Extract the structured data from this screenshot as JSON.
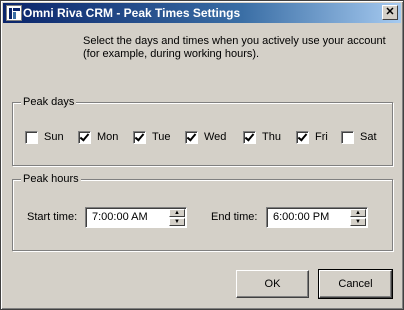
{
  "window": {
    "title": "Omni Riva CRM - Peak Times Settings",
    "close_glyph": "✕"
  },
  "intro_text": "Select the days and times when you actively use your account (for example, during working hours).",
  "peak_days": {
    "title": "Peak days",
    "days": [
      {
        "label": "Sun",
        "checked": false
      },
      {
        "label": "Mon",
        "checked": true
      },
      {
        "label": "Tue",
        "checked": true
      },
      {
        "label": "Wed",
        "checked": true
      },
      {
        "label": "Thu",
        "checked": true
      },
      {
        "label": "Fri",
        "checked": true
      },
      {
        "label": "Sat",
        "checked": false
      }
    ]
  },
  "peak_hours": {
    "title": "Peak hours",
    "start_label": "Start time:",
    "start_value": "7:00:00 AM",
    "end_label": "End time:",
    "end_value": "6:00:00 PM"
  },
  "buttons": {
    "ok": "OK",
    "cancel": "Cancel"
  },
  "icons": {
    "spin_up": "▲",
    "spin_down": "▼"
  }
}
